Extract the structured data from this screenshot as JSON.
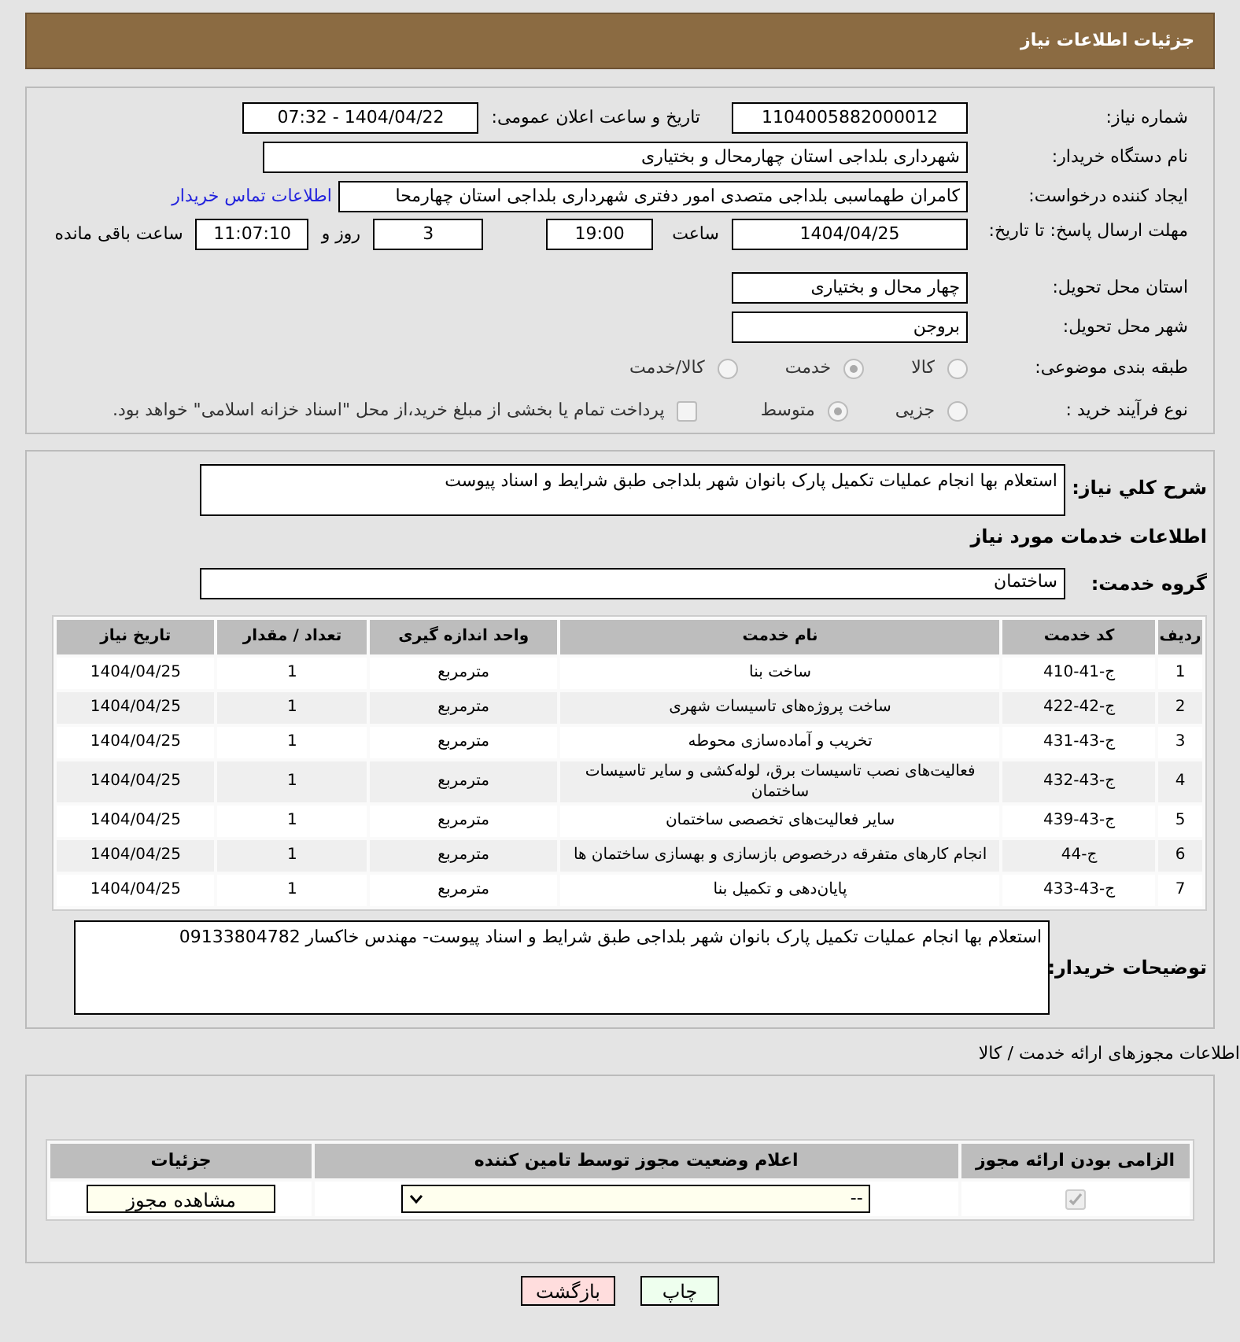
{
  "header": {
    "title": "جزئیات اطلاعات نیاز"
  },
  "need_number": {
    "label": "شماره نیاز:",
    "value": "1104005882000012"
  },
  "announce": {
    "label": "تاریخ و ساعت اعلان عمومی:",
    "value": "1404/04/22 - 07:32"
  },
  "buyer_org": {
    "label": "نام دستگاه خریدار:",
    "value": "شهرداری بلداجی استان چهارمحال و بختیاری"
  },
  "requester": {
    "label": "ایجاد کننده درخواست:",
    "value": "کامران طهماسبی بلداجی متصدی امور دفتری شهرداری بلداجی استان چهارمحا",
    "link": "اطلاعات تماس خریدار"
  },
  "deadline": {
    "label": "مهلت ارسال پاسخ: تا تاریخ:",
    "date": "1404/04/25",
    "time_label": "ساعت",
    "time": "19:00",
    "days": "3",
    "days_label": "روز و",
    "remaining": "11:07:10",
    "remaining_label": "ساعت باقی مانده"
  },
  "province": {
    "label": "استان محل تحویل:",
    "value": "چهار محال و بختیاری"
  },
  "city": {
    "label": "شهر محل تحویل:",
    "value": "بروجن"
  },
  "category": {
    "label": "طبقه بندی موضوعی:",
    "options": [
      {
        "label": "کالا",
        "selected": false
      },
      {
        "label": "خدمت",
        "selected": true
      },
      {
        "label": "کالا/خدمت",
        "selected": false
      }
    ]
  },
  "process": {
    "label": "نوع فرآیند خرید :",
    "options": [
      {
        "label": "جزیی",
        "selected": false
      },
      {
        "label": "متوسط",
        "selected": true
      }
    ],
    "payment": {
      "checked": false,
      "text": "پرداخت تمام یا بخشی از مبلغ خرید،از محل \"اسناد خزانه اسلامی\" خواهد بود."
    }
  },
  "description": {
    "label": "شرح کلي نياز:",
    "value": "استعلام بها انجام عملیات تکمیل پارک بانوان شهر بلداجی طبق شرایط و اسناد پیوست"
  },
  "services_heading": "اطلاعات خدمات مورد نیاز",
  "service_group": {
    "label": "گروه خدمت:",
    "value": "ساختمان"
  },
  "table": {
    "columns": [
      "ردیف",
      "کد خدمت",
      "نام خدمت",
      "واحد اندازه گیری",
      "تعداد / مقدار",
      "تاریخ نیاز"
    ],
    "rows": [
      [
        "1",
        "ج-41-410",
        "ساخت بنا",
        "مترمربع",
        "1",
        "1404/04/25"
      ],
      [
        "2",
        "ج-42-422",
        "ساخت پروژه‌های تاسیسات شهری",
        "مترمربع",
        "1",
        "1404/04/25"
      ],
      [
        "3",
        "ج-43-431",
        "تخریب و آماده‌سازی محوطه",
        "مترمربع",
        "1",
        "1404/04/25"
      ],
      [
        "4",
        "ج-43-432",
        "فعالیت‌های نصب تاسیسات برق، لوله‌کشی و سایر تاسیسات ساختمان",
        "مترمربع",
        "1",
        "1404/04/25"
      ],
      [
        "5",
        "ج-43-439",
        "سایر فعالیت‌های تخصصی ساختمان",
        "مترمربع",
        "1",
        "1404/04/25"
      ],
      [
        "6",
        "ج-44",
        "انجام کارهای متفرقه درخصوص بازسازی و بهسازی ساختمان ها",
        "مترمربع",
        "1",
        "1404/04/25"
      ],
      [
        "7",
        "ج-43-433",
        "پایان‌دهی و تکمیل بنا",
        "مترمربع",
        "1",
        "1404/04/25"
      ]
    ]
  },
  "buyer_notes": {
    "label": "توضیحات خریدار:",
    "value": "استعلام بها انجام عملیات تکمیل پارک بانوان شهر بلداجی طبق شرایط و اسناد پیوست- مهندس خاکسار 09133804782"
  },
  "permits": {
    "title": "اطلاعات مجوزهای ارائه خدمت / کالا",
    "columns": [
      "الزامی بودن ارائه مجوز",
      "اعلام وضعیت مجوز توسط تامین کننده",
      "جزئیات"
    ],
    "row": {
      "required": true,
      "status": "--",
      "details_button": "مشاهده مجوز"
    }
  },
  "buttons": {
    "print": "چاپ",
    "back": "بازگشت"
  }
}
